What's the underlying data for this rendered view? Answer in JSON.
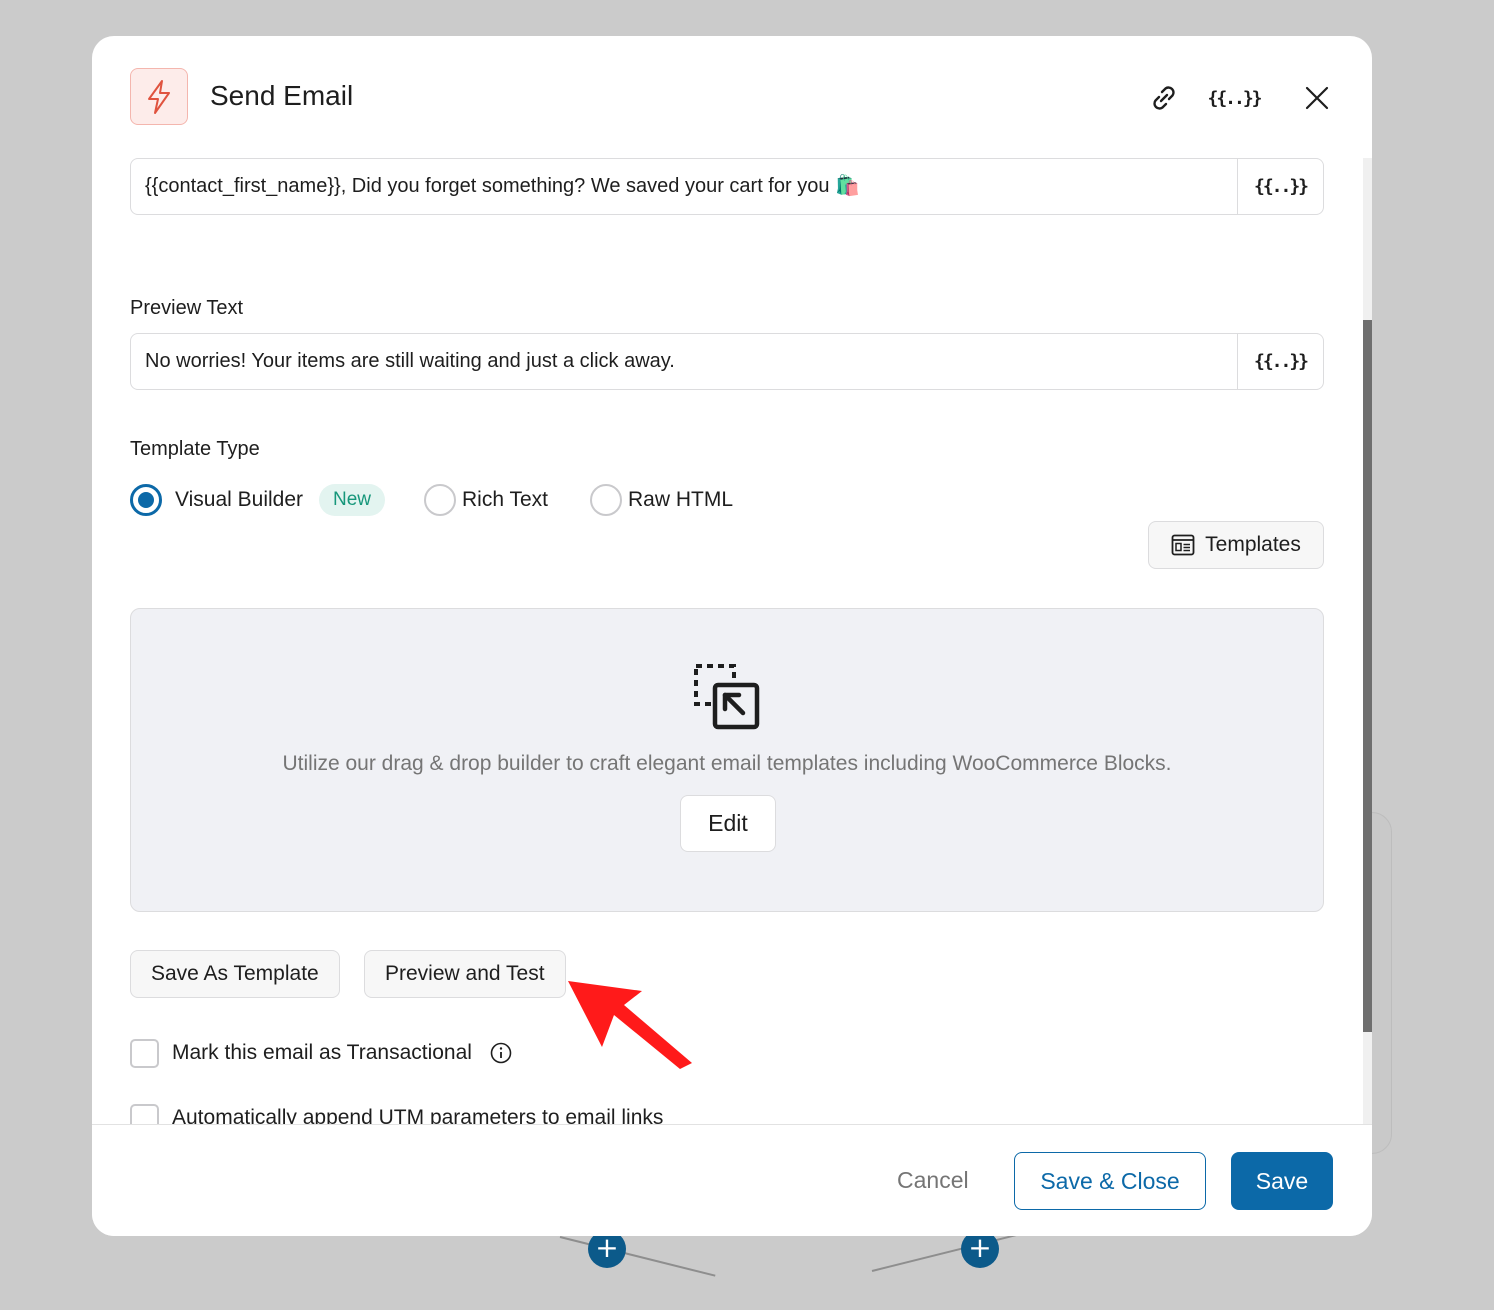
{
  "modal": {
    "title": "Send Email",
    "header_icons": [
      "bolt-icon",
      "link-icon",
      "merge-tag-icon",
      "close-icon"
    ],
    "merge_tag_glyph": "{{..}}"
  },
  "subject": {
    "value": "{{contact_first_name}}, Did you forget something? We saved your cart for you 🛍️"
  },
  "preview_text": {
    "label": "Preview Text",
    "value": "No worries! Your items are still waiting and just a click away."
  },
  "template_type": {
    "label": "Template Type",
    "options": [
      {
        "label": "Visual Builder",
        "selected": true,
        "badge": "New"
      },
      {
        "label": "Rich Text",
        "selected": false
      },
      {
        "label": "Raw HTML",
        "selected": false
      }
    ]
  },
  "templates_button": {
    "label": "Templates"
  },
  "builder": {
    "description": "Utilize our drag & drop builder to craft elegant email templates including WooCommerce Blocks.",
    "edit_label": "Edit"
  },
  "actions": {
    "save_as_template": "Save As Template",
    "preview_and_test": "Preview and Test"
  },
  "options": {
    "transactional": {
      "label": "Mark this email as Transactional",
      "checked": false
    },
    "utm": {
      "label": "Automatically append UTM parameters to email links",
      "checked": false
    }
  },
  "footer": {
    "cancel": "Cancel",
    "save_close": "Save & Close",
    "save": "Save"
  },
  "colors": {
    "accent": "#0c69a8",
    "badge_bg": "#e3f4f0",
    "badge_text": "#17977b",
    "bolt": "#e0533f",
    "annotation": "#ff1a1a"
  }
}
